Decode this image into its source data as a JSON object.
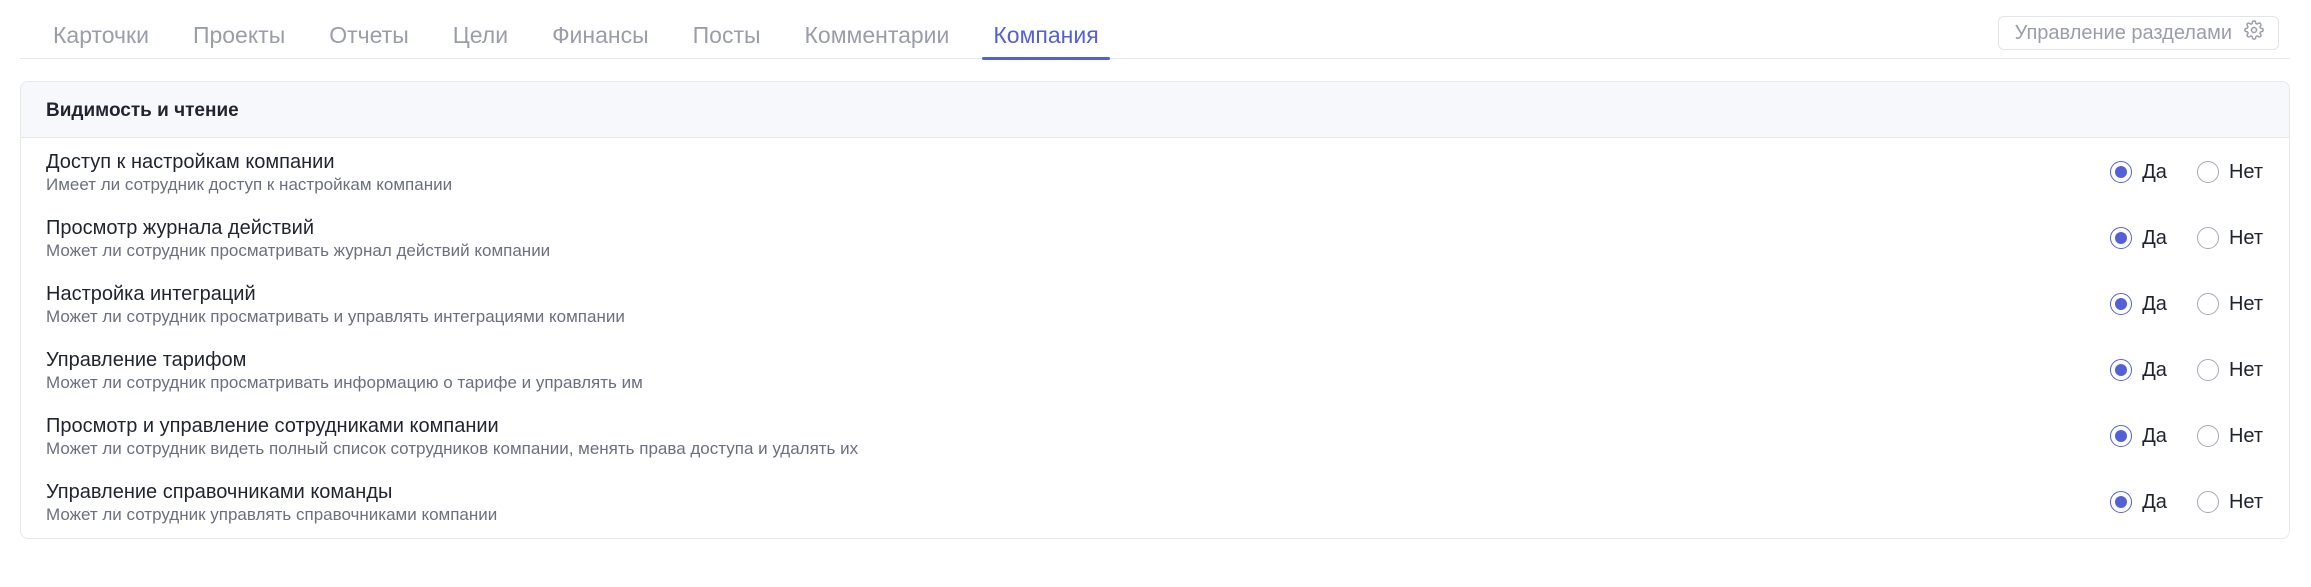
{
  "tabs": [
    {
      "label": "Карточки",
      "active": false
    },
    {
      "label": "Проекты",
      "active": false
    },
    {
      "label": "Отчеты",
      "active": false
    },
    {
      "label": "Цели",
      "active": false
    },
    {
      "label": "Финансы",
      "active": false
    },
    {
      "label": "Посты",
      "active": false
    },
    {
      "label": "Комментарии",
      "active": false
    },
    {
      "label": "Компания",
      "active": true
    }
  ],
  "manage_sections": {
    "label": "Управление разделами",
    "icon": "gear-icon"
  },
  "section": {
    "title": "Видимость и чтение",
    "option_yes": "Да",
    "option_no": "Нет",
    "rows": [
      {
        "title": "Доступ к настройкам компании",
        "description": "Имеет ли сотрудник доступ к настройкам компании",
        "value": "yes"
      },
      {
        "title": "Просмотр журнала действий",
        "description": "Может ли сотрудник просматривать журнал действий компании",
        "value": "yes"
      },
      {
        "title": "Настройка интеграций",
        "description": "Может ли сотрудник просматривать и управлять интеграциями компании",
        "value": "yes"
      },
      {
        "title": "Управление тарифом",
        "description": "Может ли сотрудник просматривать информацию о тарифе и управлять им",
        "value": "yes"
      },
      {
        "title": "Просмотр и управление сотрудниками компании",
        "description": "Может ли сотрудник видеть полный список сотрудников компании, менять права доступа и удалять их",
        "value": "yes"
      },
      {
        "title": "Управление справочниками команды",
        "description": "Может ли сотрудник управлять справочниками компании",
        "value": "yes"
      }
    ]
  },
  "colors": {
    "accent": "#5461d6",
    "muted_text": "#9a9eaa",
    "border": "#e7e8ee",
    "header_bg": "#f7f8fc"
  }
}
